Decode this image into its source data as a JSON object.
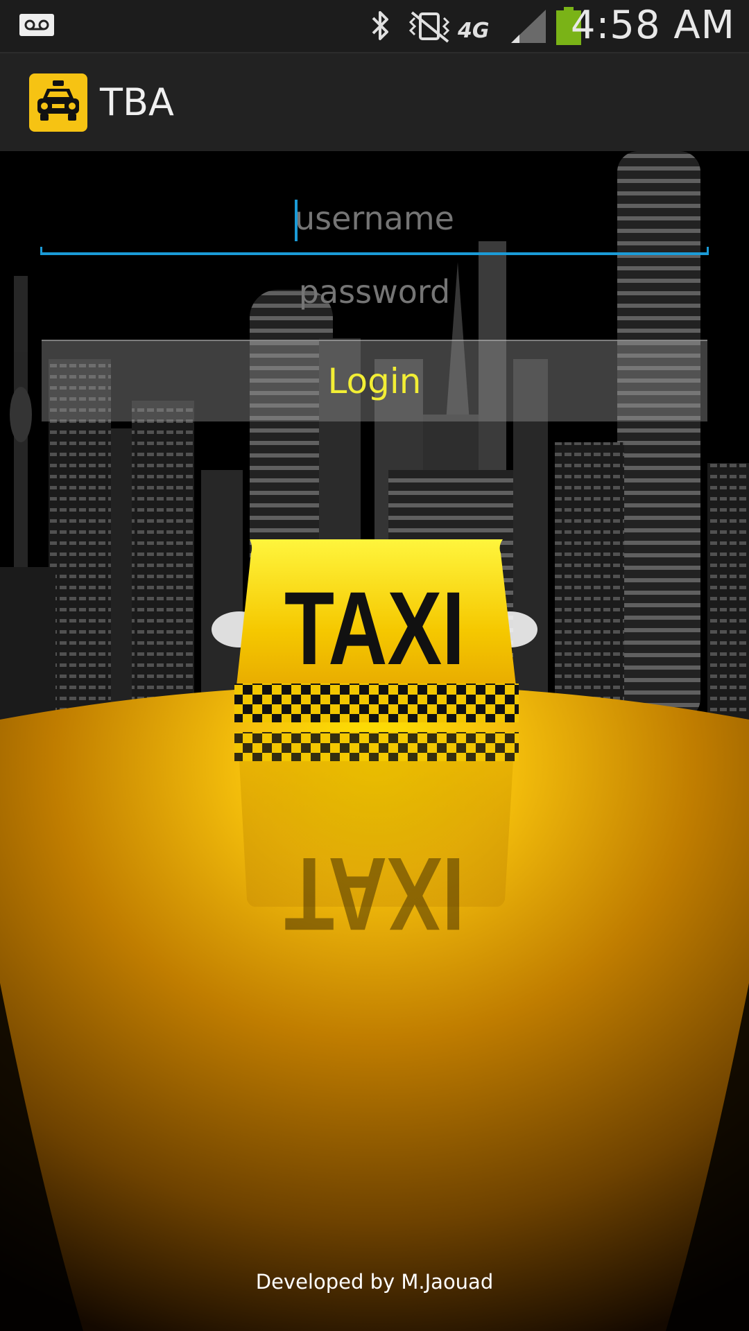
{
  "status_bar": {
    "time": "4:58 AM",
    "network": "4G",
    "icons": [
      "voicemail-icon",
      "bluetooth-icon",
      "vibrate-icon",
      "network-4g-icon",
      "signal-icon",
      "battery-icon"
    ],
    "battery_color": "#7ab317"
  },
  "action_bar": {
    "app_icon": "taxi-icon",
    "title": "TBA"
  },
  "login_form": {
    "username_placeholder": "username",
    "username_value": "",
    "password_placeholder": "password",
    "password_value": "",
    "login_label": "Login",
    "accent_color": "#1b9bd7",
    "login_text_color": "#f2ee35"
  },
  "background": {
    "sign_text": "TAXI"
  },
  "footer": {
    "credit": "Developed by M.Jaouad"
  }
}
